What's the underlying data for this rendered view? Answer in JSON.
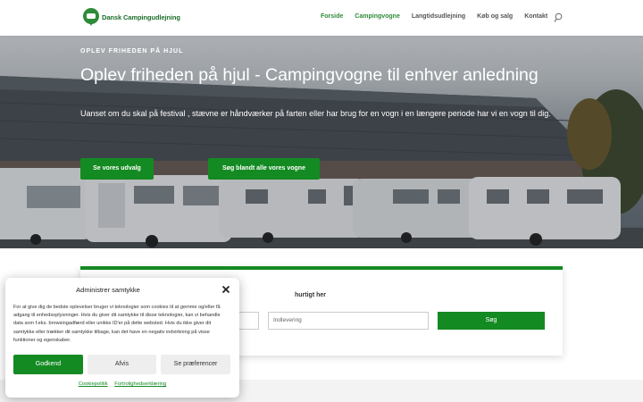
{
  "header": {
    "logo_text": "Dansk Campingudlejning",
    "nav": [
      {
        "label": "Forside",
        "active": true
      },
      {
        "label": "Campingvogne",
        "active": true
      },
      {
        "label": "Langtidsudlejning",
        "active": false
      },
      {
        "label": "Køb og salg",
        "active": false
      },
      {
        "label": "Kontakt",
        "active": false
      }
    ],
    "search_icon": "search-icon"
  },
  "hero": {
    "eyebrow": "OPLEV FRIHEDEN PÅ HJUL",
    "title": "Oplev friheden på hjul - Campingvogne til enhver anledning",
    "text": "Uanset om du skal på festival , stævne er håndværker på farten eller har brug for en vogn i en længere periode har vi en vogn til dig.",
    "button_primary": "Se vores udvalg",
    "button_secondary": "Søg blandt alle vores vogne"
  },
  "search_panel": {
    "title": "hurtigt her",
    "afhentning_placeholder": "",
    "indlevering_placeholder": "Indlevering",
    "search_button": "Søg"
  },
  "cookie": {
    "title": "Administrer samtykke",
    "body": "For at give dig de bedste oplevelser bruger vi teknologier som cookies til at gemme og/eller få adgang til enhedsoplysninger. Hvis du giver dit samtykke til disse teknologier, kan vi behandle data som f.eks. browsingadfærd eller unikke ID'er på dette websted. Hvis du ikke giver dit samtykke eller trækker dit samtykke tilbage, kan det have en negativ indvirkning på visse funktioner og egenskaber.",
    "accept": "Godkend",
    "deny": "Afvis",
    "preferences": "Se præferencer",
    "link_cookie_policy": "Cookiepolitik",
    "link_privacy": "Fortrolighedserklæring"
  },
  "colors": {
    "brand_green": "#148a22",
    "nav_active": "#2e8b3a"
  }
}
